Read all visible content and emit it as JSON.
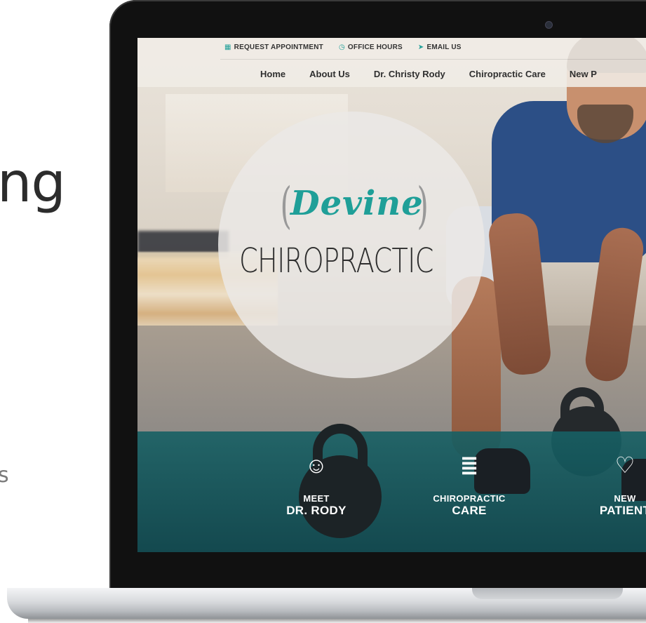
{
  "left_text": {
    "heading_fragment": "ng",
    "sub_fragment": "s"
  },
  "site": {
    "topbar": [
      {
        "icon": "calendar-icon",
        "glyph": "▦",
        "label": "REQUEST APPOINTMENT"
      },
      {
        "icon": "clock-icon",
        "glyph": "◷",
        "label": "OFFICE HOURS"
      },
      {
        "icon": "paper-plane-icon",
        "glyph": "➤",
        "label": "EMAIL US"
      }
    ],
    "nav": [
      "Home",
      "About Us",
      "Dr. Christy Rody",
      "Chiropractic Care",
      "New P"
    ],
    "logo": {
      "script": "Devine",
      "word": "CHIROPRACTIC"
    },
    "ctas": [
      {
        "icon": "doctor-icon",
        "glyph": "☺",
        "line1": "MEET",
        "line2": "DR. RODY"
      },
      {
        "icon": "spine-icon",
        "glyph": "≣",
        "line1": "CHIROPRACTIC",
        "line2": "CARE"
      },
      {
        "icon": "heart-icon",
        "glyph": "♡",
        "line1": "NEW",
        "line2": "PATIENT"
      }
    ],
    "accent_color": "#1f9f98",
    "band_color": "#0e464c"
  }
}
